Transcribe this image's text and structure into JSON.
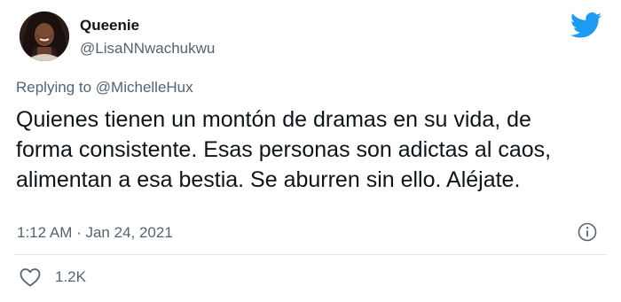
{
  "author": {
    "display_name": "Queenie",
    "handle": "@LisaNNwachukwu"
  },
  "reply": {
    "prefix": "Replying to",
    "mention": "@MichelleHux"
  },
  "tweet": {
    "line1": "Quienes tienen un montón de dramas en su vida, de",
    "line2": "forma consistente. Esas personas son adictas al caos,",
    "line3": "alimentan a esa bestia. Se aburren sin ello. Aléjate."
  },
  "meta": {
    "timestamp": "1:12 AM · Jan 24, 2021"
  },
  "engagement": {
    "likes": "1.2K"
  },
  "icons": {
    "brand": "twitter-bird-icon",
    "info": "info-icon",
    "like": "heart-icon"
  },
  "colors": {
    "brand_blue": "#1d9bf0",
    "secondary_text": "#536471",
    "primary_text": "#0f1419",
    "divider": "#e1e8ed"
  }
}
